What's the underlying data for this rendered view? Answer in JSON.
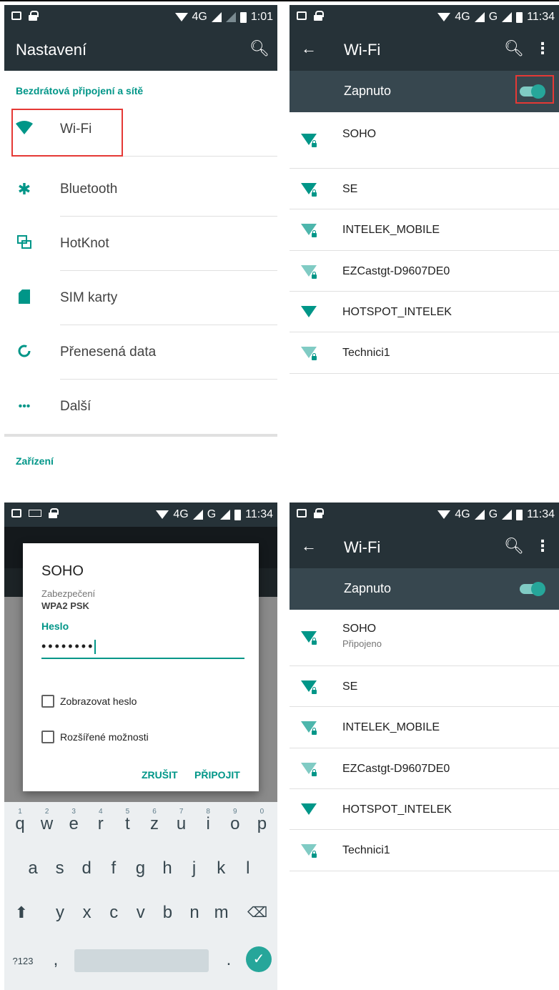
{
  "panel1": {
    "status": {
      "net": "4G",
      "time": "1:01"
    },
    "toolbar": {
      "title": "Nastavení"
    },
    "category_wireless": "Bezdrátová připojení a sítě",
    "items": [
      {
        "label": "Wi-Fi",
        "icon": "wifi-icon"
      },
      {
        "label": "Bluetooth",
        "icon": "bluetooth-icon"
      },
      {
        "label": "HotKnot",
        "icon": "hotknot-icon"
      },
      {
        "label": "SIM karty",
        "icon": "sim-card-icon"
      },
      {
        "label": "Přenesená data",
        "icon": "data-usage-icon"
      },
      {
        "label": "Další",
        "icon": "more-icon"
      }
    ],
    "category_device": "Zařízení"
  },
  "panel2": {
    "status": {
      "net": "4G",
      "net2": "G",
      "time": "11:34"
    },
    "toolbar": {
      "title": "Wi-Fi"
    },
    "switch_label": "Zapnuto",
    "switch_on": true,
    "networks": [
      {
        "name": "SOHO",
        "status": "",
        "signal": 1,
        "locked": true
      },
      {
        "name": "SE",
        "status": "",
        "signal": 1,
        "locked": true
      },
      {
        "name": "INTELEK_MOBILE",
        "status": "",
        "signal": 2,
        "locked": true
      },
      {
        "name": "EZCastgt-D9607DE0",
        "status": "",
        "signal": 3,
        "locked": true
      },
      {
        "name": "HOTSPOT_INTELEK",
        "status": "",
        "signal": 1,
        "locked": false
      },
      {
        "name": "Technici1",
        "status": "",
        "signal": 3,
        "locked": true
      }
    ]
  },
  "panel3": {
    "status": {
      "net": "4G",
      "net2": "G",
      "time": "11:34"
    },
    "dialog": {
      "title": "SOHO",
      "security_label": "Zabezpečení",
      "security_value": "WPA2 PSK",
      "password_label": "Heslo",
      "password_value": "••••••••",
      "show_password": "Zobrazovat heslo",
      "advanced": "Rozšířené možnosti",
      "cancel": "ZRUŠIT",
      "connect": "PŘIPOJIT"
    },
    "keyboard": {
      "row1": [
        "q",
        "w",
        "e",
        "r",
        "t",
        "z",
        "u",
        "i",
        "o",
        "p"
      ],
      "row1_hints": [
        "1",
        "2",
        "3",
        "4",
        "5",
        "6",
        "7",
        "8",
        "9",
        "0"
      ],
      "row2": [
        "a",
        "s",
        "d",
        "f",
        "g",
        "h",
        "j",
        "k",
        "l"
      ],
      "row3": [
        "y",
        "x",
        "c",
        "v",
        "b",
        "n",
        "m"
      ],
      "symbols": "?123",
      "comma": ",",
      "period": "."
    }
  },
  "panel4": {
    "status": {
      "net": "4G",
      "net2": "G",
      "time": "11:34"
    },
    "toolbar": {
      "title": "Wi-Fi"
    },
    "switch_label": "Zapnuto",
    "networks": [
      {
        "name": "SOHO",
        "status": "Připojeno"
      },
      {
        "name": "SE",
        "status": ""
      },
      {
        "name": "INTELEK_MOBILE",
        "status": ""
      },
      {
        "name": "EZCastgt-D9607DE0",
        "status": ""
      },
      {
        "name": "HOTSPOT_INTELEK",
        "status": ""
      },
      {
        "name": "Technici1",
        "status": ""
      }
    ]
  },
  "colors": {
    "accent": "#009688",
    "toolbar_dark": "#263238",
    "switch_bar": "#37474f",
    "highlight": "#e53935"
  }
}
